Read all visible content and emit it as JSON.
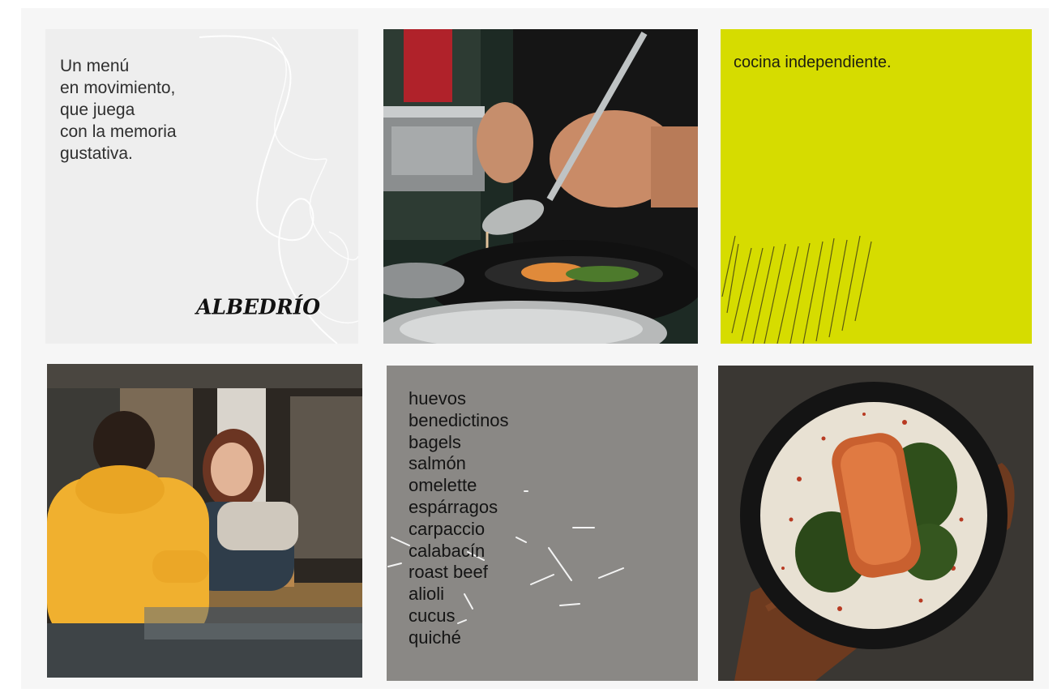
{
  "tile_1": {
    "text_lines": [
      "Un menú",
      "en movimiento,",
      "que juega",
      "con la memoria",
      "gustativa."
    ],
    "logo_text": "ALBEDRÍO"
  },
  "tile_3": {
    "text": "cocina independiente."
  },
  "tile_5": {
    "items": [
      "huevos",
      "benedictinos",
      "bagels",
      "salmón",
      "omelette",
      "espárragos",
      "carpaccio",
      "calabacín",
      "roast beef",
      "alioli",
      "cucus",
      "quiché"
    ]
  },
  "colors": {
    "lime": "#d6dc00",
    "gray_tile": "#8a8885",
    "light_tile": "#eeeeee"
  }
}
